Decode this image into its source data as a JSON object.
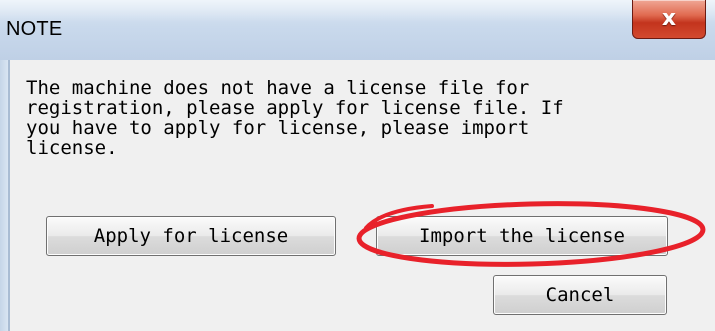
{
  "dialog": {
    "title": "NOTE",
    "close_glyph": "x",
    "message_lines": [
      "The machine does not have a license file for",
      "registration, please apply for license file. If",
      "you have to apply for license, please import",
      "license."
    ],
    "buttons": {
      "apply": "Apply for license",
      "import": "Import the license",
      "cancel": "Cancel"
    },
    "annotation": {
      "shape": "ellipse",
      "color": "#e8212a",
      "target": "import-license-button"
    }
  }
}
